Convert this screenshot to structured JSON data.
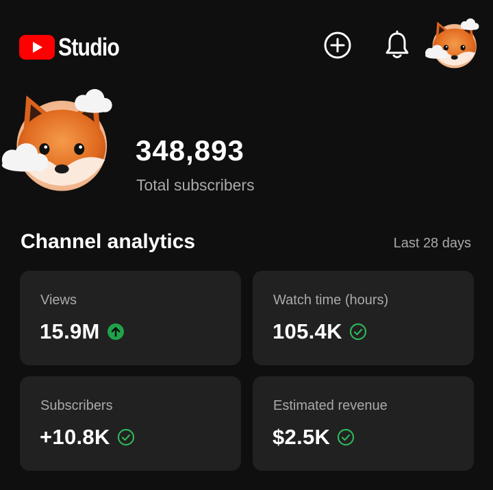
{
  "app": {
    "logo_text": "Studio",
    "brand_color": "#ff0000",
    "icons": {
      "create": "add-circle-icon",
      "notifications": "bell-icon",
      "avatar": "fox-avatar-icon"
    }
  },
  "channel": {
    "subscriber_count": "348,893",
    "subscriber_label": "Total subscribers"
  },
  "analytics": {
    "title": "Channel analytics",
    "period": "Last 28 days",
    "cards": [
      {
        "label": "Views",
        "value": "15.9M",
        "status": "up",
        "status_icon": "arrow-up-circle-icon",
        "status_color": "#1fa24a"
      },
      {
        "label": "Watch time (hours)",
        "value": "105.4K",
        "status": "ok",
        "status_icon": "check-circle-icon",
        "status_color": "#2fb45a"
      },
      {
        "label": "Subscribers",
        "value": "+10.8K",
        "status": "ok",
        "status_icon": "check-circle-icon",
        "status_color": "#2fb45a"
      },
      {
        "label": "Estimated revenue",
        "value": "$2.5K",
        "status": "ok",
        "status_icon": "check-circle-icon",
        "status_color": "#2fb45a"
      }
    ]
  }
}
